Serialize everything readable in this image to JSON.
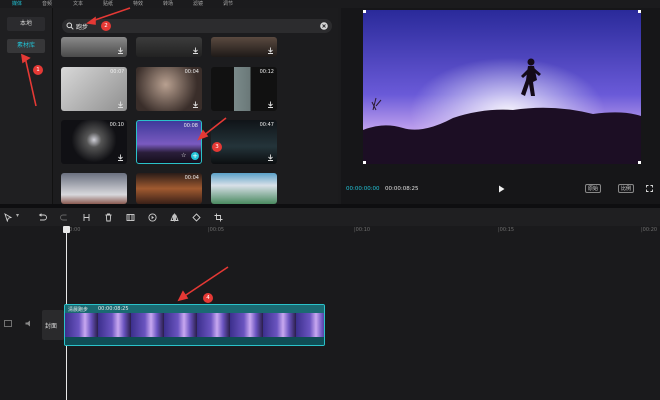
{
  "top_tabs": [
    "媒体",
    "音频",
    "文本",
    "贴纸",
    "特效",
    "转场",
    "滤镜",
    "调节"
  ],
  "left_nav": {
    "local": "本地",
    "library": "素材库"
  },
  "search": {
    "value": "跑步"
  },
  "thumbnails": [
    {
      "duration": "",
      "has_add": false
    },
    {
      "duration": "",
      "has_add": false
    },
    {
      "duration": "",
      "has_add": false
    },
    {
      "duration": "00:0?",
      "has_add": false
    },
    {
      "duration": "00:04",
      "has_add": false
    },
    {
      "duration": "00:12",
      "has_add": false
    },
    {
      "duration": "00:10",
      "has_add": false
    },
    {
      "duration": "00:08",
      "has_add": true
    },
    {
      "duration": "00:47",
      "has_add": false
    },
    {
      "duration": "",
      "has_add": false
    },
    {
      "duration": "00:04",
      "has_add": false
    },
    {
      "duration": "",
      "has_add": false
    }
  ],
  "player": {
    "current_time": "00:00:00:00",
    "total_time": "00:00:08:25",
    "original_button": "原始",
    "ratio_button": "比例"
  },
  "ruler": [
    "00:00",
    "|00:05",
    "|00:10",
    "|00:15",
    "|00:20"
  ],
  "track": {
    "clip_name": "清晨跑步",
    "clip_duration": "00:00:08:25",
    "cover_label": "封面"
  },
  "annotations": [
    "1",
    "2",
    "3",
    "4"
  ],
  "colors": {
    "accent": "#22c3d6",
    "annotation": "#e53935",
    "clip_border": "#2ac2c9"
  }
}
